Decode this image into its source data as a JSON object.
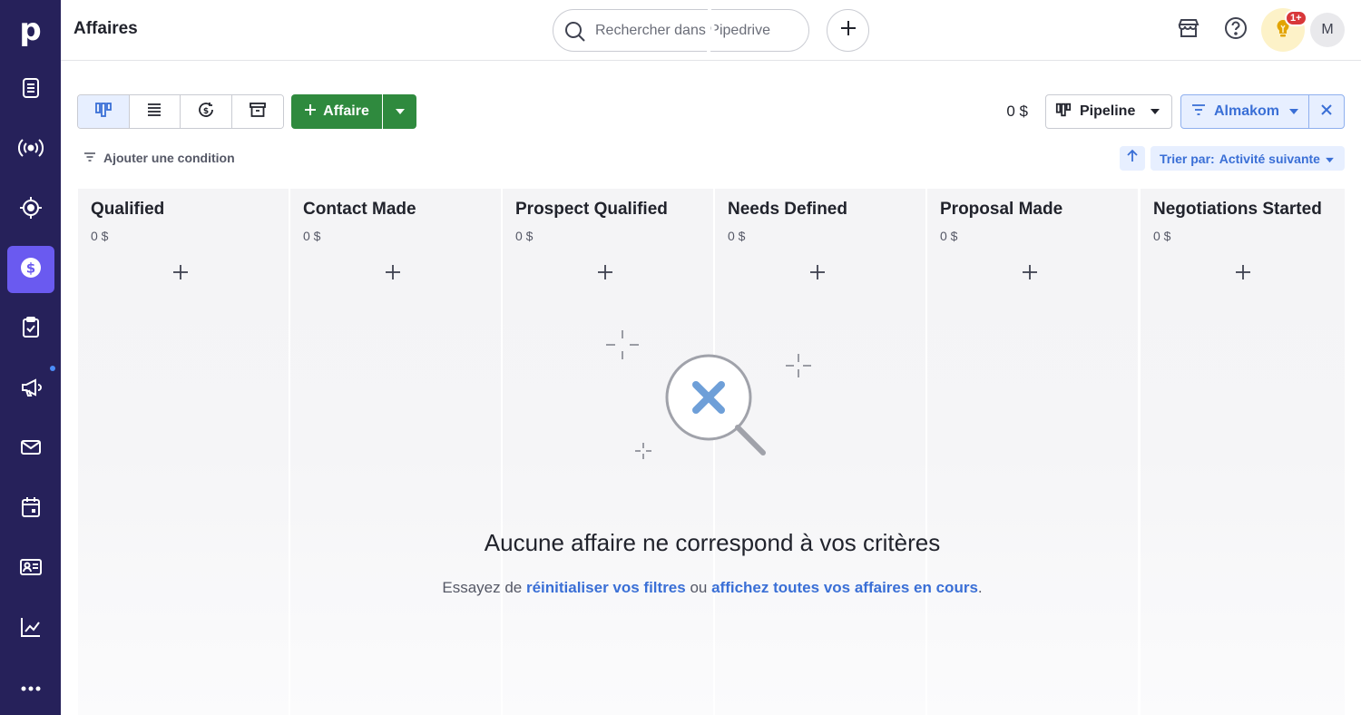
{
  "app": {
    "logo_letter": "p",
    "page_title": "Affaires"
  },
  "sidebar": {
    "items": [
      {
        "name": "leads-inbox",
        "icon": "leads-icon"
      },
      {
        "name": "campaigns-live",
        "icon": "broadcast-icon"
      },
      {
        "name": "goals",
        "icon": "target-icon"
      },
      {
        "name": "deals",
        "icon": "dollar-icon",
        "active": true
      },
      {
        "name": "activities",
        "icon": "clipboard-check-icon"
      },
      {
        "name": "campaigns",
        "icon": "megaphone-icon",
        "has_dot": true
      },
      {
        "name": "mail",
        "icon": "envelope-icon"
      },
      {
        "name": "calendar",
        "icon": "calendar-icon"
      },
      {
        "name": "contacts",
        "icon": "contact-card-icon"
      },
      {
        "name": "insights",
        "icon": "chart-icon"
      },
      {
        "name": "more",
        "icon": "more-icon"
      }
    ],
    "colors": {
      "background": "#26215a",
      "active": "#6a5af0"
    }
  },
  "topbar": {
    "search_placeholder": "Rechercher dans Pipedrive",
    "notification_badge": "1+",
    "avatar_initial": "M"
  },
  "toolbar": {
    "views": [
      "pipeline-view",
      "list-view",
      "forecast-view",
      "archive-view"
    ],
    "active_view": "pipeline-view",
    "add_deal_label": "Affaire",
    "total_value": "0 $",
    "pipeline_label": "Pipeline",
    "filter_label": "Almakom",
    "add_condition_label": "Ajouter une condition",
    "sort_prefix": "Trier par:",
    "sort_value": "Activité suivante"
  },
  "stages": [
    {
      "name": "Qualified",
      "value": "0 $"
    },
    {
      "name": "Contact Made",
      "value": "0 $"
    },
    {
      "name": "Prospect Qualified",
      "value": "0 $"
    },
    {
      "name": "Needs Defined",
      "value": "0 $"
    },
    {
      "name": "Proposal Made",
      "value": "0 $"
    },
    {
      "name": "Negotiations Started",
      "value": "0 $"
    }
  ],
  "empty_state": {
    "title": "Aucune affaire ne correspond à vos critères",
    "hint_prefix": "Essayez de ",
    "reset_link": "réinitialiser vos filtres",
    "hint_middle": " ou ",
    "show_all_link": "affichez toutes vos affaires en cours",
    "hint_suffix": "."
  },
  "colors": {
    "accent_blue": "#3a6fd6",
    "add_green": "#2f8a3e",
    "badge_red": "#d8373a"
  }
}
